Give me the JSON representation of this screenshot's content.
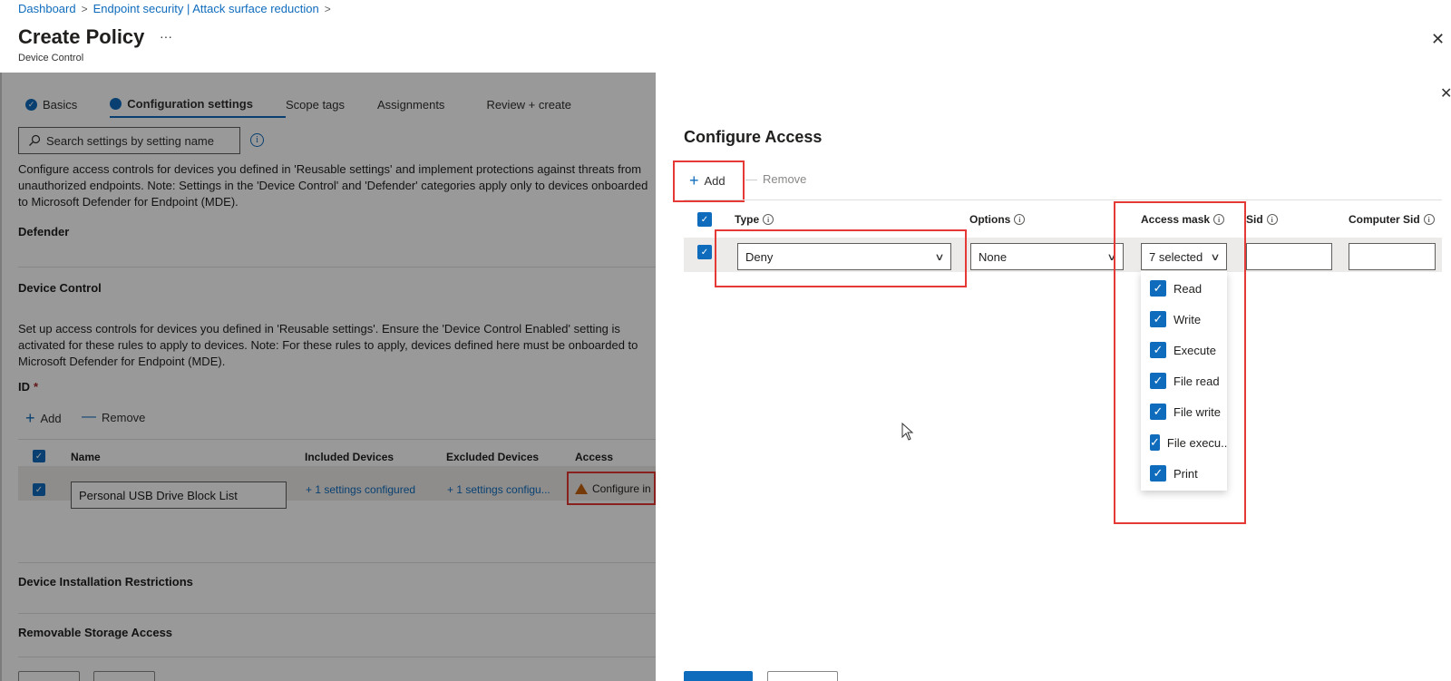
{
  "breadcrumb": {
    "items": [
      "Dashboard",
      "Endpoint security | Attack surface reduction"
    ],
    "separator": ">"
  },
  "header": {
    "title": "Create Policy",
    "more": "···",
    "subtitle": "Device Control",
    "close": "✕"
  },
  "tabs": [
    {
      "label": "Basics",
      "state": "completed"
    },
    {
      "label": "Configuration settings",
      "state": "active"
    },
    {
      "label": "Scope tags",
      "state": "pending"
    },
    {
      "label": "Assignments",
      "state": "pending"
    },
    {
      "label": "Review + create",
      "state": "pending"
    }
  ],
  "search": {
    "placeholder": "Search settings by setting name"
  },
  "left": {
    "intro": "Configure access controls for devices you defined in 'Reusable settings' and implement protections against threats from unauthorized endpoints. Note: Settings in the 'Device Control' and 'Defender' categories apply only to devices onboarded to Microsoft Defender for Endpoint (MDE).",
    "section_defender": "Defender",
    "section_device_control": "Device Control",
    "device_control_desc": "Set up access controls for devices you defined in 'Reusable settings'. Ensure the 'Device Control Enabled' setting is activated for these rules to apply to devices. Note: For these rules to apply, devices defined here must be onboarded to Microsoft Defender for Endpoint (MDE).",
    "id_label": "ID",
    "required_mark": "*",
    "add_label": "Add",
    "remove_label": "Remove",
    "table": {
      "headers": [
        "Name",
        "Included Devices",
        "Excluded Devices",
        "Access"
      ],
      "row": {
        "name": "Personal USB Drive Block List",
        "included": "+ 1 settings configured",
        "excluded": "+ 1 settings configu...",
        "access": "Configure in"
      }
    },
    "section_installation": "Device Installation Restrictions",
    "section_removable": "Removable Storage Access"
  },
  "blade": {
    "title": "Configure Access",
    "close": "✕",
    "add_label": "Add",
    "remove_label": "Remove",
    "columns": {
      "type": "Type",
      "options": "Options",
      "access_mask": "Access mask",
      "sid": "Sid",
      "computer_sid": "Computer Sid"
    },
    "row": {
      "type": "Deny",
      "options": "None",
      "access_mask": "7 selected"
    },
    "access_mask_options": [
      "Read",
      "Write",
      "Execute",
      "File read",
      "File write",
      "File execu...",
      "Print"
    ]
  },
  "colors": {
    "accent": "#0f6cbd",
    "highlight": "#e53935",
    "warning": "#c4620c"
  }
}
